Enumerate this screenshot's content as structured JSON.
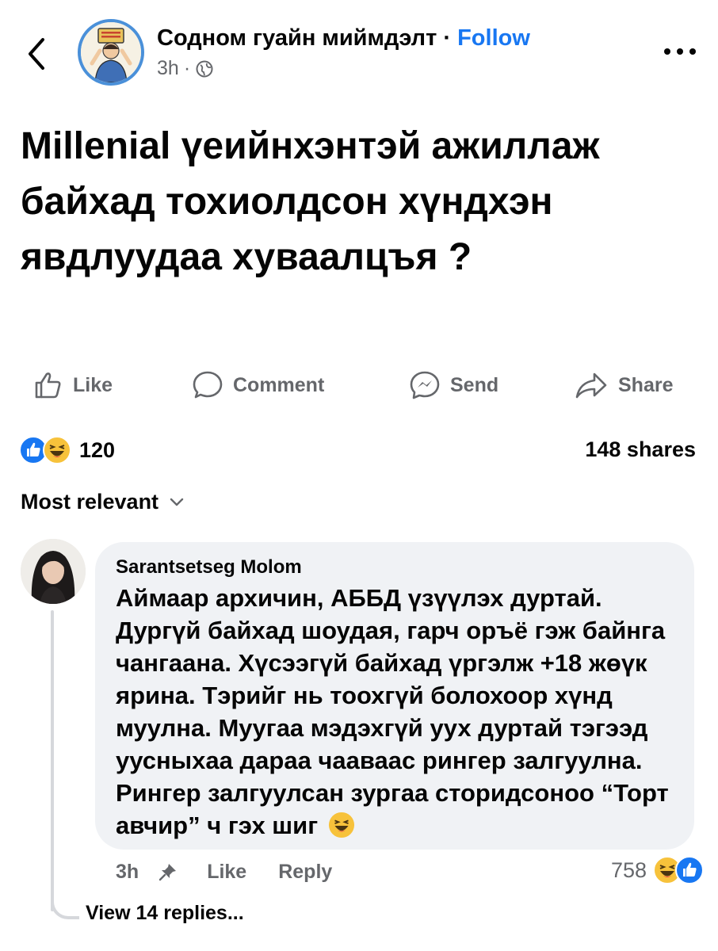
{
  "header": {
    "page_name": "Содном гуайн миймдэлт",
    "separator": "·",
    "follow_label": "Follow",
    "time": "3h",
    "meta_sep": "·",
    "audience_icon": "globe-icon",
    "more_icon": "ellipsis-icon",
    "back_icon": "chevron-left-icon"
  },
  "post": {
    "text": "Millenial үеийнхэнтэй ажиллаж байхад тохиолдсон хүндхэн явдлуудаа хуваалцъя ?"
  },
  "actions": {
    "like": "Like",
    "comment": "Comment",
    "send": "Send",
    "share": "Share"
  },
  "stats": {
    "reaction_count": "120",
    "shares": "148 shares",
    "reaction_icons": [
      "like-reaction-icon",
      "haha-reaction-icon"
    ]
  },
  "sort": {
    "label": "Most relevant"
  },
  "comment": {
    "author": "Sarantsetseg Molom",
    "text": "Аймаар архичин, АББД үзүүлэх дуртай. Дургүй байхад шоудая, гарч оръё гэж байнга чангаана. Хүсээгүй байхад үргэлж +18 жөүк ярина. Тэрийг нь тоохгүй болохоор хүнд муулна. Муугаа мэдэхгүй уух дуртай тэгээд уусныхаа дараа чааваас рингер залгуулна. Рингер залгуулсан зургаа сторидсоноо “Торт авчир” ч гэх шиг",
    "time": "3h",
    "like_label": "Like",
    "reply_label": "Reply",
    "reaction_count": "758",
    "view_replies": "View 14 replies..."
  },
  "colors": {
    "accent": "#1877f2",
    "secondary_text": "#65676b",
    "bubble": "#f0f2f5"
  }
}
